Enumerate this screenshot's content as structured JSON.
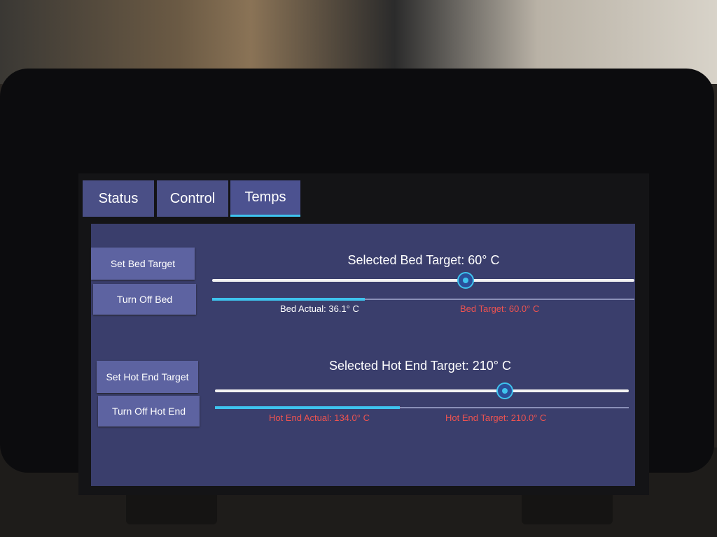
{
  "tabs": [
    {
      "label": "Status"
    },
    {
      "label": "Control"
    },
    {
      "label": "Temps"
    }
  ],
  "active_tab": "Temps",
  "bed": {
    "set_button": "Set Bed Target",
    "off_button": "Turn Off Bed",
    "selected_label": "Selected Bed Target: 60° C",
    "slider_value": 60,
    "slider_max": 100,
    "actual_value": 36.1,
    "actual_max": 100,
    "actual_label": "Bed Actual: 36.1° C",
    "target_label": "Bed Target: 60.0° C",
    "actual_color": "#ffffff"
  },
  "hotend": {
    "set_button": "Set Hot End Target",
    "off_button": "Turn Off Hot End",
    "selected_label": "Selected Hot End Target: 210° C",
    "slider_value": 210,
    "slider_max": 300,
    "actual_value": 134.0,
    "actual_max": 300,
    "actual_label": "Hot End Actual: 134.0° C",
    "target_label": "Hot End Target: 210.0° C",
    "actual_color": "#ef5350"
  },
  "colors": {
    "accent": "#3ec3ee",
    "warning": "#ef5350",
    "panel": "#3a3e6c",
    "button": "#5d63a1"
  }
}
